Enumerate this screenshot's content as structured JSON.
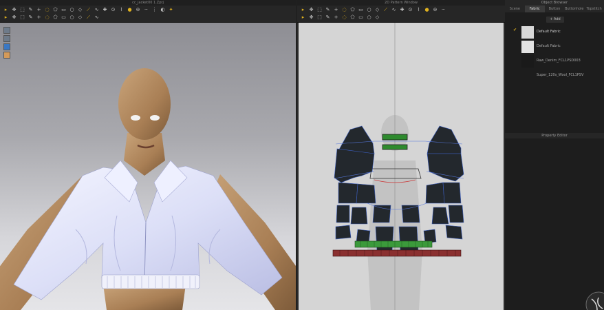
{
  "window3d": {
    "title": "cc_jacket00 1.Zprj"
  },
  "window2d": {
    "title": "2D Pattern Window"
  },
  "right_panel": {
    "title": "Object Browser",
    "tabs": [
      "Scene",
      "Fabric",
      "Button",
      "Buttonhole",
      "Topstitch"
    ],
    "active_tab": "Fabric",
    "add_label": "+ Add",
    "fabrics": [
      {
        "name": "Default Fabric",
        "swatch": "#d8d8d8",
        "selected": true
      },
      {
        "name": "Default Fabric",
        "swatch": "#e2e2e2",
        "selected": false
      },
      {
        "name": "Raw_Denim_FCL1PSD003",
        "swatch": "#1a1a1a",
        "selected": false
      },
      {
        "name": "Super_120s_Wool_FCL1PSV",
        "swatch": "#1d1d1d",
        "selected": false
      }
    ],
    "property_editor": "Property Editor"
  },
  "colors": {
    "accent": "#e0b21f",
    "pattern_piece": "#23282d",
    "rib_green": "#3b9a3b",
    "rib_red": "#8a3030",
    "outline_blue": "#5577dd"
  },
  "icons3d": [
    "select-icon",
    "move-icon",
    "transform-icon",
    "edit-pattern-icon",
    "add-point-icon",
    "curve-point-icon",
    "polygon-icon",
    "rectangle-icon",
    "circle-icon",
    "internal-polygon-icon",
    "seam-icon",
    "free-seam-icon",
    "tack-icon",
    "pin-icon",
    "fold-icon",
    "button-icon",
    "buttonhole-icon",
    "topstitch-icon",
    "zipper-icon",
    "texture-icon",
    "brush-icon"
  ],
  "icons2d": [
    "pattern-select-icon",
    "pattern-move-icon",
    "pattern-edit-icon",
    "add-point-icon",
    "curve-point-icon",
    "polygon-icon",
    "rectangle-icon",
    "circle-icon",
    "internal-icon",
    "segment-seam-icon",
    "free-seam-icon",
    "check-seam-icon",
    "notch-icon",
    "symmetry-icon",
    "grading-icon",
    "fold-icon",
    "arrange-icon",
    "elastic-icon"
  ]
}
